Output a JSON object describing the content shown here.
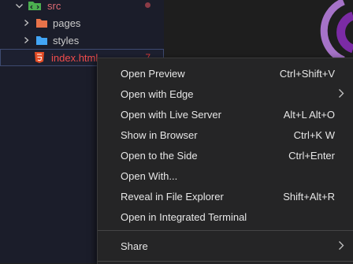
{
  "explorer": {
    "src": {
      "label": "src"
    },
    "items": [
      {
        "label": "pages",
        "icon": "folder-orange-icon"
      },
      {
        "label": "styles",
        "icon": "folder-blue-icon"
      }
    ],
    "file": {
      "label": "index.html",
      "badge": "7",
      "icon": "html5-icon"
    }
  },
  "context_menu": {
    "items": [
      {
        "label": "Open Preview",
        "shortcut": "Ctrl+Shift+V"
      },
      {
        "label": "Open with Edge",
        "shortcut": ""
      },
      {
        "label": "Open with Live Server",
        "shortcut": "Alt+L Alt+O"
      },
      {
        "label": "Show in Browser",
        "shortcut": "Ctrl+K W"
      },
      {
        "label": "Open to the Side",
        "shortcut": "Ctrl+Enter"
      },
      {
        "label": "Open With...",
        "shortcut": ""
      },
      {
        "label": "Reveal in File Explorer",
        "shortcut": "Shift+Alt+R"
      },
      {
        "label": "Open in Integrated Terminal",
        "shortcut": ""
      }
    ],
    "share": {
      "label": "Share"
    }
  },
  "colors": {
    "accent_purple": "#7b2ba5",
    "html_red": "#e44d26",
    "folder_orange": "#e8734a",
    "folder_blue": "#42a5f5"
  }
}
